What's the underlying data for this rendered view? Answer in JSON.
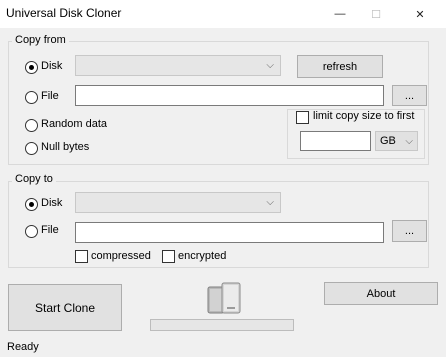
{
  "window": {
    "title": "Universal Disk Cloner",
    "minimize_glyph": "—",
    "maximize_glyph": "☐",
    "close_glyph": "✕"
  },
  "copy_from": {
    "legend": "Copy from",
    "disk_label": "Disk",
    "disk_value": "",
    "refresh_label": "refresh",
    "file_label": "File",
    "file_value": "",
    "browse_label": "...",
    "random_label": "Random data",
    "null_label": "Null bytes",
    "limit_label": "limit copy size to first",
    "limit_value": "",
    "unit_value": "GB"
  },
  "copy_to": {
    "legend": "Copy to",
    "disk_label": "Disk",
    "disk_value": "",
    "file_label": "File",
    "file_value": "",
    "browse_label": "...",
    "compressed_label": "compressed",
    "encrypted_label": "encrypted"
  },
  "actions": {
    "start_label": "Start Clone",
    "about_label": "About"
  },
  "progress": {
    "fraction": 0
  },
  "status": {
    "text": "Ready"
  }
}
